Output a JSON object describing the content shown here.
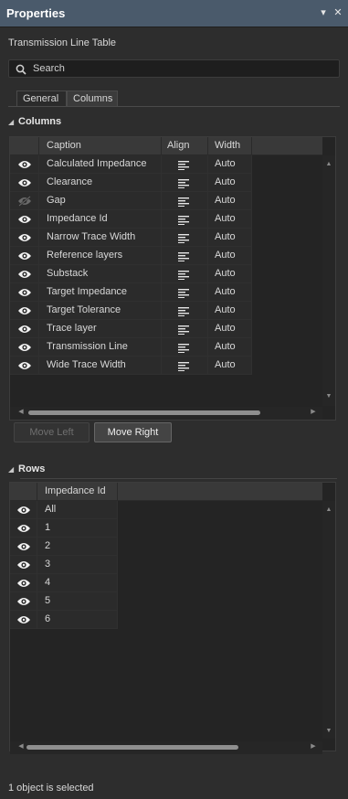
{
  "titlebar": {
    "title": "Properties",
    "menu_glyph": "▾",
    "close_glyph": "✕"
  },
  "panel": {
    "subtitle": "Transmission Line Table"
  },
  "search": {
    "placeholder": "Search",
    "icon": "search-icon"
  },
  "tabs": [
    {
      "label": "General",
      "active": false
    },
    {
      "label": "Columns",
      "active": true
    }
  ],
  "columns_section": {
    "label": "Columns",
    "headers": {
      "visibility": "",
      "caption": "Caption",
      "align": "Align",
      "width": "Width"
    },
    "rows": [
      {
        "visible": true,
        "caption": "Calculated Impedance",
        "align": "left",
        "width": "Auto"
      },
      {
        "visible": true,
        "caption": "Clearance",
        "align": "left",
        "width": "Auto"
      },
      {
        "visible": false,
        "caption": "Gap",
        "align": "left",
        "width": "Auto"
      },
      {
        "visible": true,
        "caption": "Impedance Id",
        "align": "left",
        "width": "Auto"
      },
      {
        "visible": true,
        "caption": "Narrow Trace Width",
        "align": "left",
        "width": "Auto"
      },
      {
        "visible": true,
        "caption": "Reference layers",
        "align": "left",
        "width": "Auto"
      },
      {
        "visible": true,
        "caption": "Substack",
        "align": "left",
        "width": "Auto"
      },
      {
        "visible": true,
        "caption": "Target Impedance",
        "align": "left",
        "width": "Auto"
      },
      {
        "visible": true,
        "caption": "Target Tolerance",
        "align": "left",
        "width": "Auto"
      },
      {
        "visible": true,
        "caption": "Trace layer",
        "align": "left",
        "width": "Auto"
      },
      {
        "visible": true,
        "caption": "Transmission Line",
        "align": "left",
        "width": "Auto"
      },
      {
        "visible": true,
        "caption": "Wide Trace Width",
        "align": "left",
        "width": "Auto"
      }
    ],
    "buttons": {
      "move_left": "Move Left",
      "move_right": "Move Right"
    }
  },
  "rows_section": {
    "label": "Rows",
    "header": "Impedance Id",
    "rows": [
      {
        "visible": true,
        "value": "All"
      },
      {
        "visible": true,
        "value": "1"
      },
      {
        "visible": true,
        "value": "2"
      },
      {
        "visible": true,
        "value": "3"
      },
      {
        "visible": true,
        "value": "4"
      },
      {
        "visible": true,
        "value": "5"
      },
      {
        "visible": true,
        "value": "6"
      }
    ]
  },
  "status": {
    "text": "1 object is selected"
  },
  "colors": {
    "titlebar": "#4a5a6b",
    "background": "#2d2d2d",
    "grid": "#242424",
    "text": "#d8d8d8"
  }
}
